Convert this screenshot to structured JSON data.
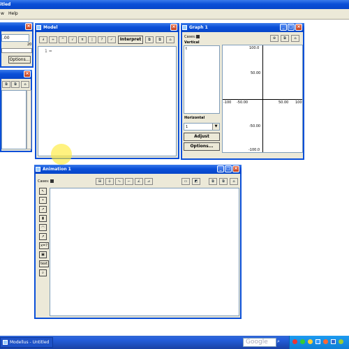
{
  "app": {
    "title_fragment": "itled"
  },
  "menu": {
    "items": [
      "w",
      "Help"
    ]
  },
  "left_panel": {
    "value": ".00",
    "slider_value": "20",
    "options_label": "Options..."
  },
  "model_window": {
    "title": "Model",
    "interpret_label": "Interpret",
    "entry_prefix": "1 ="
  },
  "graph_window": {
    "title": "Graph 1",
    "cases_label": "Cases:",
    "vertical_label": "Vertical",
    "vertical_var": "t",
    "horizontal_label": "Horizontal",
    "horizontal_value": "1",
    "adjust_label": "Adjust",
    "options_label": "Options...",
    "x_ticks": [
      "-100",
      "-50.00",
      "50.00",
      "100"
    ],
    "y_ticks": [
      "100.0",
      "50.00",
      "-50.00",
      "-100.0"
    ]
  },
  "animation_window": {
    "title": "Animation 1",
    "cases_label": "Cases:",
    "side_tools": [
      "cursor",
      "point",
      "vector",
      "bar",
      "meter",
      "graph",
      "x=?",
      "image",
      "text",
      "zoom"
    ],
    "x_eq_label": "x=?",
    "text_label": "text"
  },
  "taskbar": {
    "task_label": "Modellus - Untitled",
    "search_placeholder": "Google"
  }
}
